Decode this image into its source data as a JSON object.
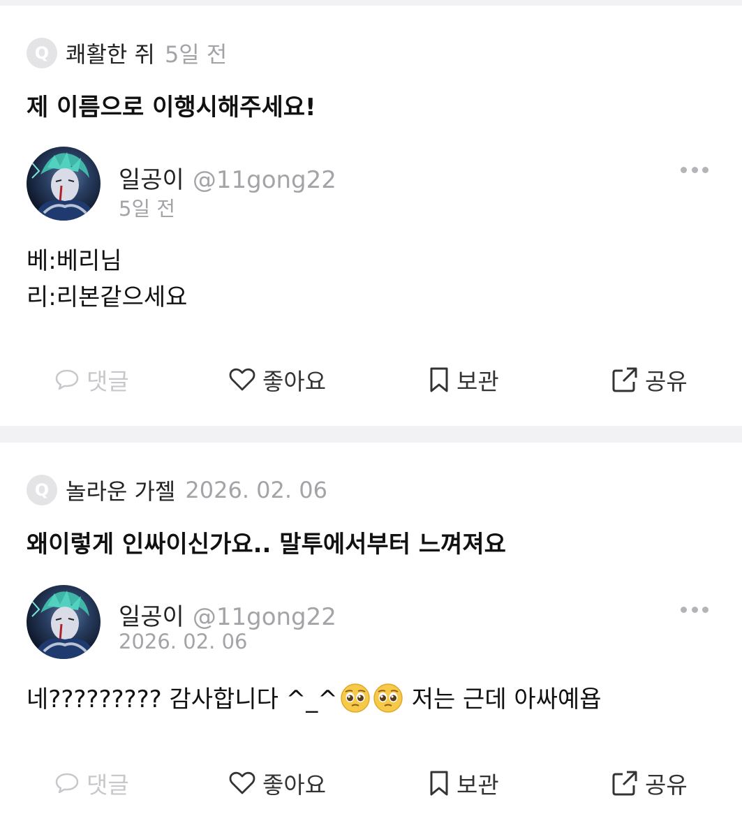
{
  "posts": [
    {
      "question": {
        "badge": "Q",
        "author": "쾌활한 쥐",
        "time": "5일 전",
        "text": "제 이름으로 이행시해주세요!"
      },
      "answer": {
        "name": "일공이",
        "handle": "@11gong22",
        "time": "5일 전",
        "lines": [
          "베:베리님",
          "리:리본같으세요"
        ]
      },
      "actions": {
        "comment": "댓글",
        "like": "좋아요",
        "save": "보관",
        "share": "공유"
      }
    },
    {
      "question": {
        "badge": "Q",
        "author": "놀라운 가젤",
        "time": "2026. 02. 06",
        "text": "왜이렇게 인싸이신가요.. 말투에서부터 느껴져요"
      },
      "answer": {
        "name": "일공이",
        "handle": "@11gong22",
        "time": "2026. 02. 06",
        "line_before_emoji": "네????????? 감사합니다 ^_^",
        "line_after_emoji": "저는 근데 아싸예욥",
        "emoji": [
          "pleading-face-emoji",
          "pleading-face-emoji"
        ]
      },
      "actions": {
        "comment": "댓글",
        "like": "좋아요",
        "save": "보관",
        "share": "공유"
      }
    }
  ],
  "colors": {
    "divider": "#f2f2f4",
    "muted": "#a3a3a8",
    "disabled": "#c8c8cc",
    "text": "#111111"
  }
}
